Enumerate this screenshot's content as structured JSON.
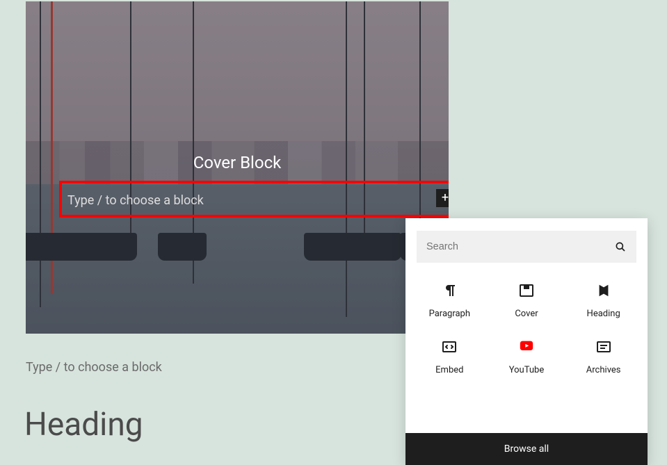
{
  "cover": {
    "title": "Cover Block",
    "placeholder": "Type / to choose a block"
  },
  "editor": {
    "paragraph_placeholder": "Type / to choose a block",
    "heading": "Heading"
  },
  "inserter": {
    "search_placeholder": "Search",
    "browse_all": "Browse all",
    "options": [
      {
        "label": "Paragraph",
        "icon": "paragraph"
      },
      {
        "label": "Cover",
        "icon": "cover"
      },
      {
        "label": "Heading",
        "icon": "heading"
      },
      {
        "label": "Embed",
        "icon": "embed"
      },
      {
        "label": "YouTube",
        "icon": "youtube"
      },
      {
        "label": "Archives",
        "icon": "archives"
      }
    ]
  },
  "colors": {
    "highlight": "#ff0000",
    "youtube": "#ff0000"
  }
}
